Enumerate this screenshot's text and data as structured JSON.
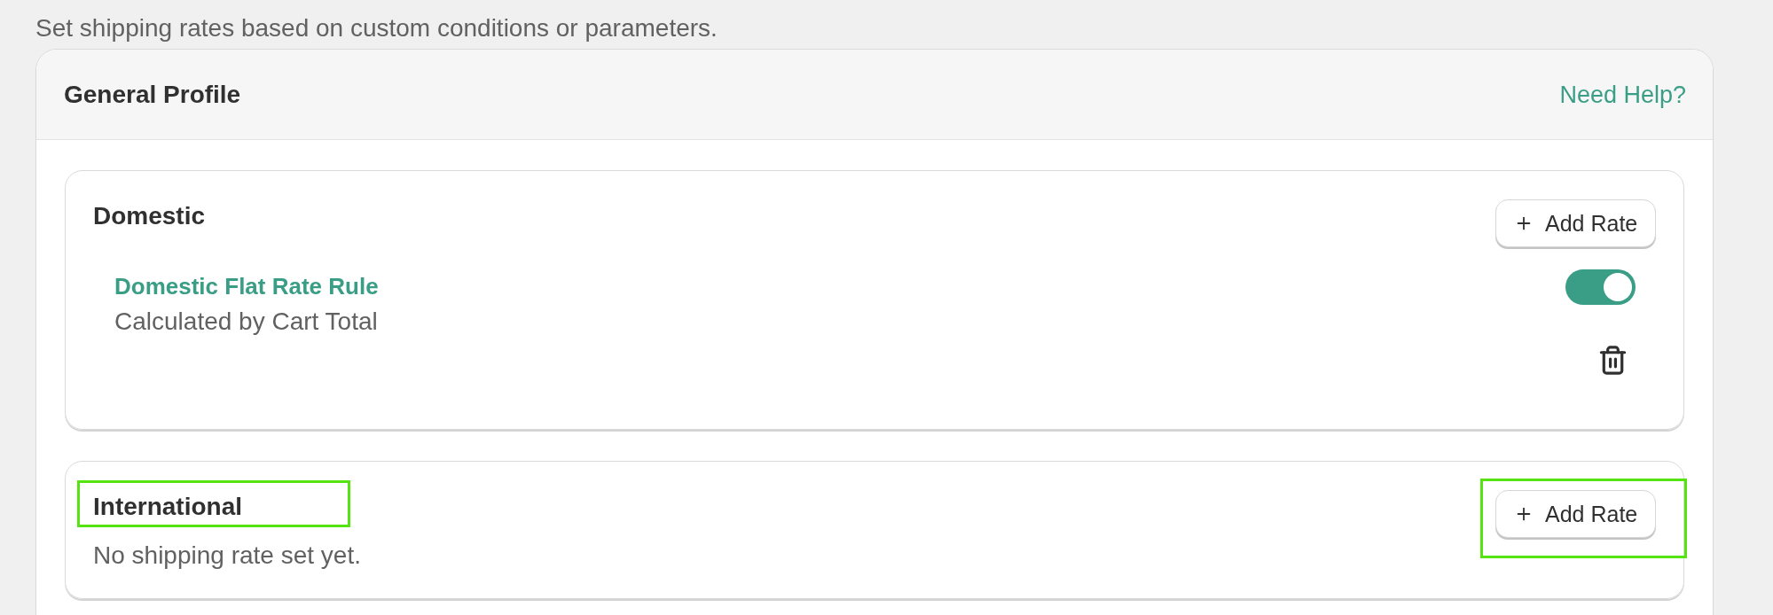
{
  "page": {
    "subtitle": "Set shipping rates based on custom conditions or parameters."
  },
  "profile": {
    "title": "General Profile",
    "help_link": "Need Help?"
  },
  "sections": [
    {
      "title": "Domestic",
      "title_highlighted": false,
      "add_button": {
        "label": "Add Rate",
        "highlighted": false
      },
      "rates": [
        {
          "name": "Domestic Flat Rate Rule",
          "description": "Calculated by Cart Total",
          "on": true
        }
      ]
    },
    {
      "title": "International",
      "title_highlighted": true,
      "add_button": {
        "label": "Add Rate",
        "highlighted": true
      },
      "empty_message": "No shipping rate set yet."
    }
  ]
}
